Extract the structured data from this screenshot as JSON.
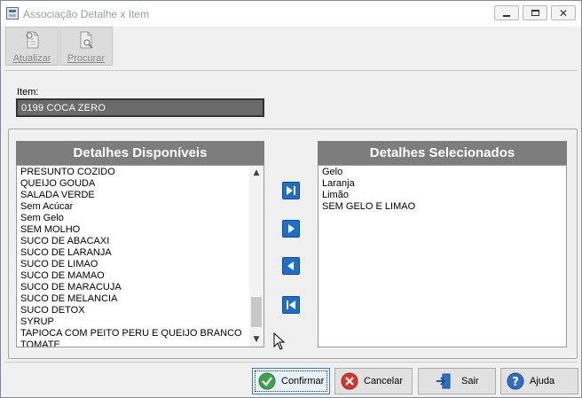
{
  "window": {
    "title": "Associação Detalhe x Item"
  },
  "toolbar": {
    "atualizar_label": "Atualizar",
    "procurar_label": "Procurar"
  },
  "item": {
    "label": "Item:",
    "value": "0199  COCA ZERO"
  },
  "available": {
    "header": "Detalhes Disponíveis",
    "items": [
      "PRESUNTO COZIDO",
      "QUEIJO GOUDA",
      "SALADA VERDE",
      "Sem Acúcar",
      "Sem Gelo",
      "SEM MOLHO",
      "SUCO DE ABACAXI",
      "SUCO DE LARANJA",
      "SUCO DE LIMAO",
      "SUCO DE MAMAO",
      "SUCO DE MARACUJA",
      "SUCO DE MELANCIA",
      "SUCO DETOX",
      "SYRUP",
      "TAPIOCA COM PEITO PERU E QUEIJO BRANCO",
      "TOMATE"
    ]
  },
  "selected": {
    "header": "Detalhes Selecionados",
    "items": [
      "Gelo",
      "Laranja",
      "Limão",
      "SEM GELO E LIMAO"
    ]
  },
  "buttons": {
    "confirmar": "Confirmar",
    "cancelar": "Cancelar",
    "sair": "Sair",
    "ajuda": "Ajuda"
  },
  "colors": {
    "header_bg": "#7d7d7d",
    "move_button": "#1f6fc9",
    "confirm_icon": "#3fa34d",
    "cancel_icon": "#d9342b",
    "help_icon": "#2d6fc4"
  },
  "icons": {
    "move_all_right": "skip-forward-icon",
    "move_one_right": "play-right-icon",
    "move_one_left": "play-left-icon",
    "move_all_left": "skip-back-icon"
  }
}
